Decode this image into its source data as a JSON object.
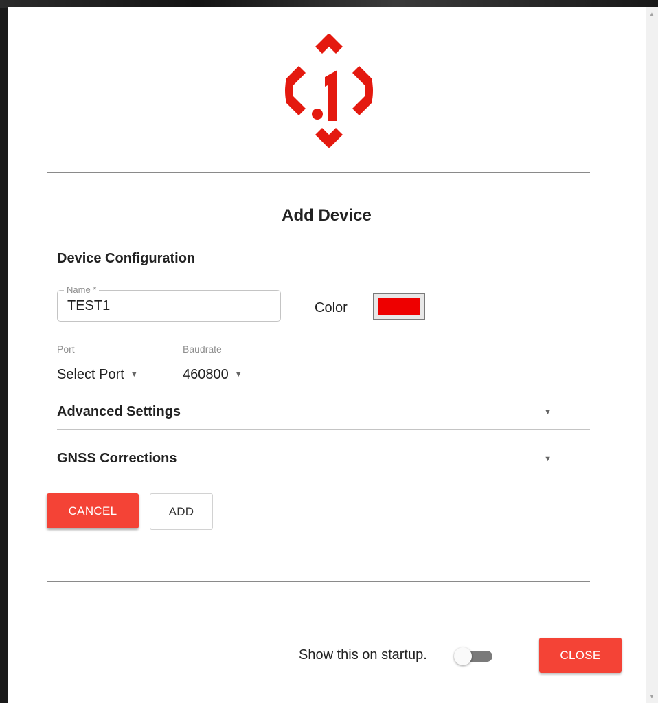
{
  "window": {
    "scroll_up_icon": "triangle-up",
    "scroll_down_icon": "triangle-down"
  },
  "logo": {
    "icon": "inertial-sense-logo",
    "color": "#e4190f",
    "text": ".1"
  },
  "dialog": {
    "title": "Add Device"
  },
  "device_config": {
    "section_title": "Device Configuration",
    "name": {
      "label": "Name *",
      "value": "TEST1"
    },
    "color": {
      "label": "Color",
      "value": "#ee0000"
    },
    "port": {
      "label": "Port",
      "value": "Select Port",
      "icon": "caret-down"
    },
    "baudrate": {
      "label": "Baudrate",
      "value": "460800",
      "icon": "caret-down"
    }
  },
  "sections": {
    "advanced_settings": {
      "label": "Advanced Settings",
      "expanded": false
    },
    "gnss_corrections": {
      "label": "GNSS Corrections",
      "expanded": false
    }
  },
  "buttons": {
    "cancel": "CANCEL",
    "add": "ADD",
    "close": "CLOSE"
  },
  "footer": {
    "startup_label": "Show this on startup.",
    "startup_toggle_on": false
  },
  "colors": {
    "accent": "#f44336",
    "divider": "#8a8a8a"
  }
}
